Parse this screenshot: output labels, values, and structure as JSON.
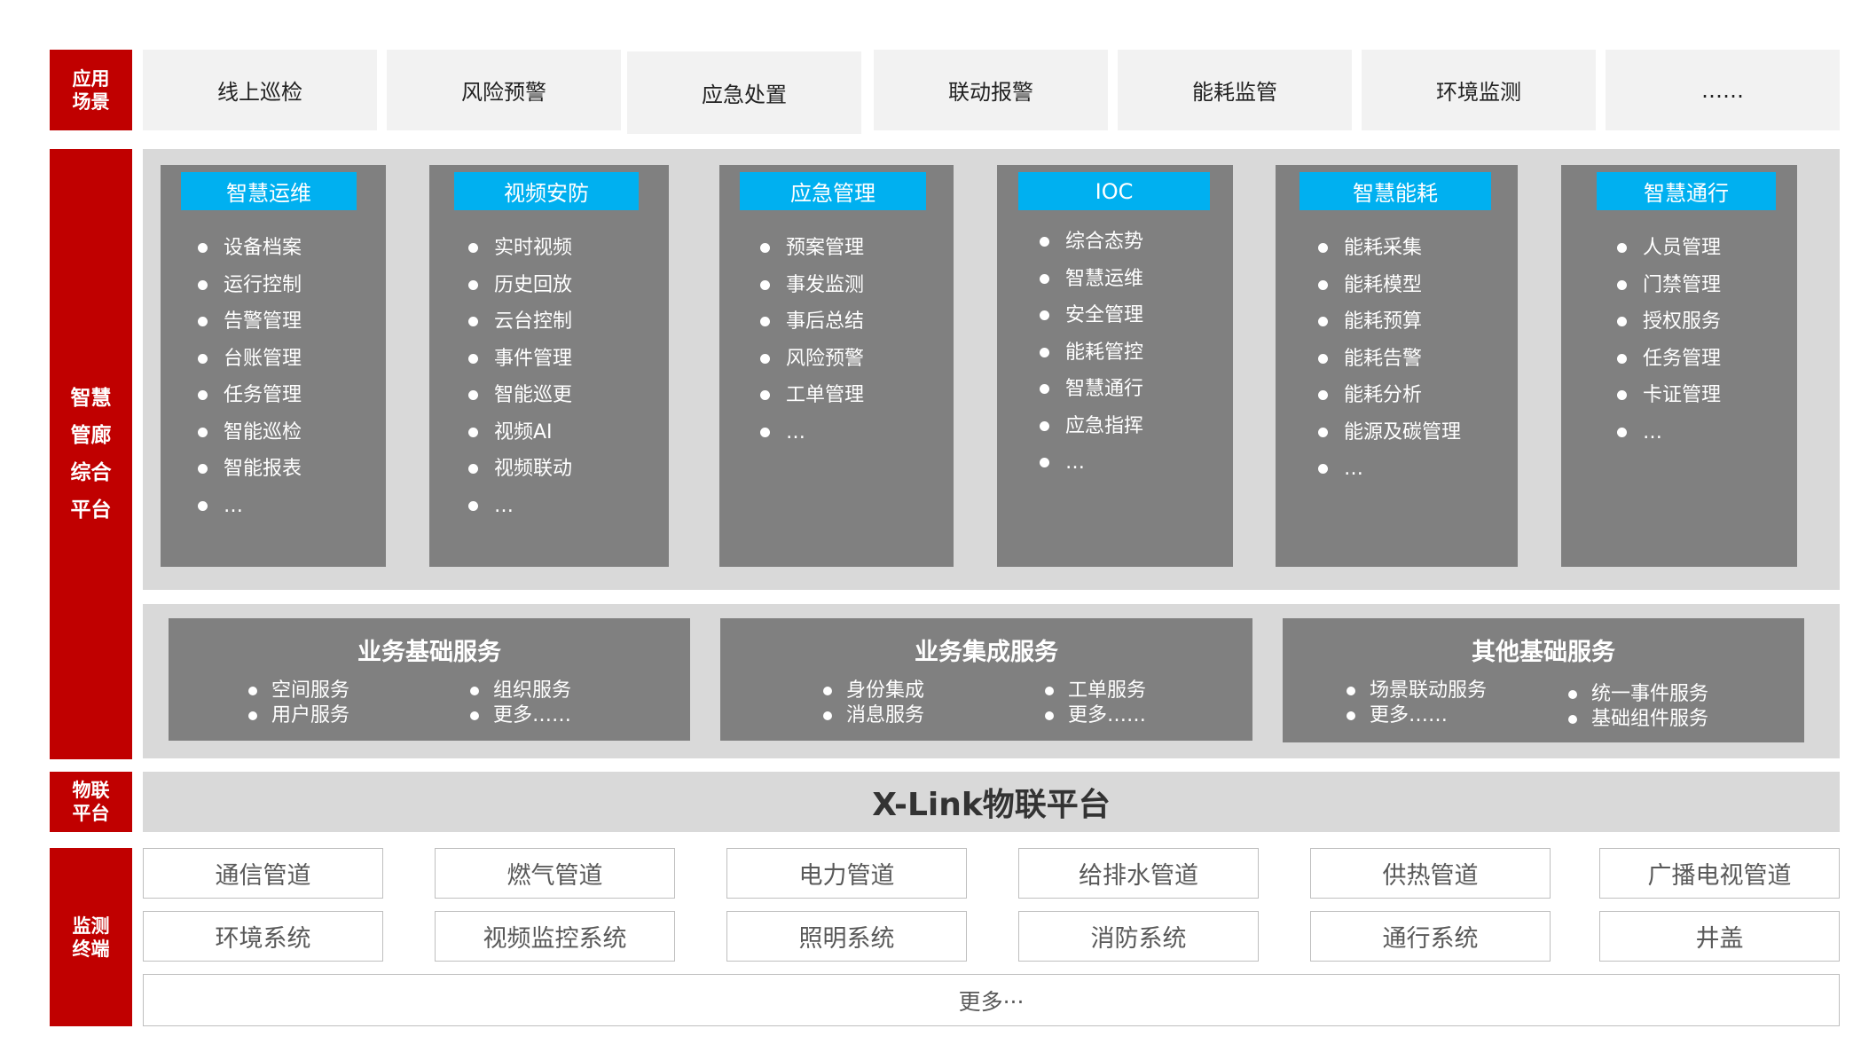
{
  "labels": {
    "scenarios": "应用\n场景",
    "platform": "智慧\n管廊\n综合\n平台",
    "iot": "物联\n平台",
    "terminals": "监测\n终端"
  },
  "scenarios": [
    "线上巡检",
    "风险预警",
    "应急处置",
    "联动报警",
    "能耗监管",
    "环境监测",
    "……"
  ],
  "modules": [
    {
      "title": "智慧运维",
      "items": [
        "设备档案",
        "运行控制",
        "告警管理",
        "台账管理",
        "任务管理",
        "智能巡检",
        "智能报表",
        "…"
      ]
    },
    {
      "title": "视频安防",
      "items": [
        "实时视频",
        "历史回放",
        "云台控制",
        "事件管理",
        "智能巡更",
        "视频AI",
        "视频联动",
        "…"
      ]
    },
    {
      "title": "应急管理",
      "items": [
        "预案管理",
        "事发监测",
        "事后总结",
        "风险预警",
        "工单管理",
        "…"
      ]
    },
    {
      "title": "IOC",
      "items": [
        "综合态势",
        "智慧运维",
        "安全管理",
        "能耗管控",
        "智慧通行",
        "应急指挥",
        "…"
      ]
    },
    {
      "title": "智慧能耗",
      "items": [
        "能耗采集",
        "能耗模型",
        "能耗预算",
        "能耗告警",
        "能耗分析",
        "能源及碳管理",
        "…"
      ]
    },
    {
      "title": "智慧通行",
      "items": [
        "人员管理",
        "门禁管理",
        "授权服务",
        "任务管理",
        "卡证管理",
        "…"
      ]
    }
  ],
  "services": [
    {
      "title": "业务基础服务",
      "col1": [
        "空间服务",
        "用户服务"
      ],
      "col2": [
        "组织服务",
        "更多……"
      ]
    },
    {
      "title": "业务集成服务",
      "col1": [
        "身份集成",
        "消息服务"
      ],
      "col2": [
        "工单服务",
        "更多……"
      ]
    },
    {
      "title": "其他基础服务",
      "col1": [
        "场景联动服务",
        "更多……"
      ],
      "col2": [
        "统一事件服务",
        "基础组件服务"
      ]
    }
  ],
  "iot_platform": "X-Link物联平台",
  "terminals": {
    "row1": [
      "通信管道",
      "燃气管道",
      "电力管道",
      "给排水管道",
      "供热管道",
      "广播电视管道"
    ],
    "row2": [
      "环境系统",
      "视频监控系统",
      "照明系统",
      "消防系统",
      "通行系统",
      "井盖"
    ],
    "more": "更多···"
  }
}
